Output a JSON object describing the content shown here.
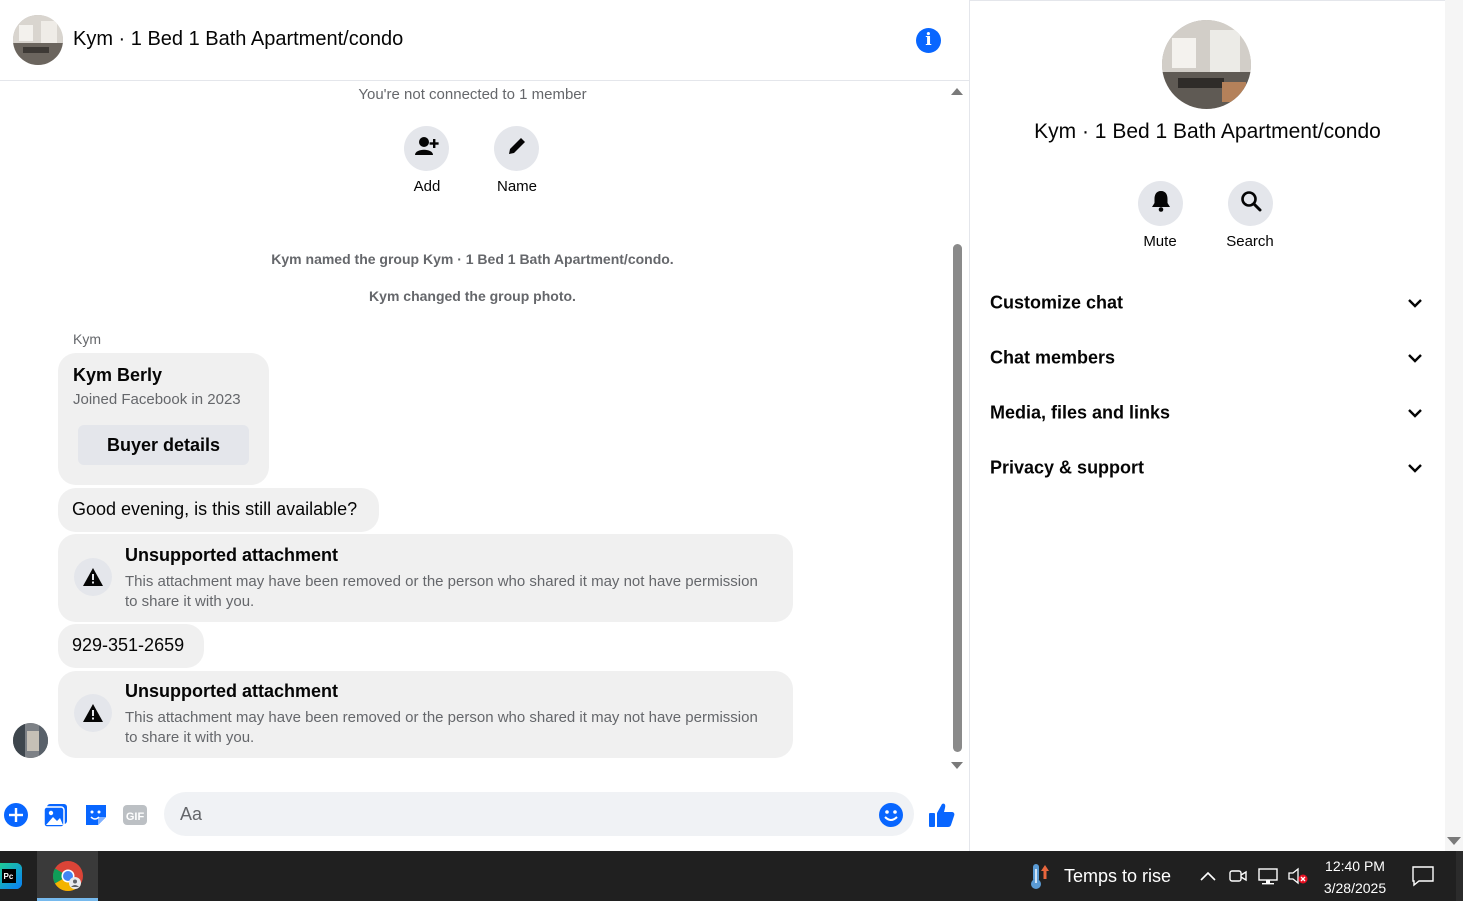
{
  "header": {
    "title": "Kym · 1 Bed 1 Bath Apartment/condo"
  },
  "chat": {
    "connection_notice": "You're not connected to 1 member",
    "actions": [
      {
        "label": "Add",
        "icon": "add-person-icon"
      },
      {
        "label": "Name",
        "icon": "pencil-icon"
      }
    ],
    "system_messages": [
      "Kym named the group Kym · 1 Bed 1 Bath Apartment/condo.",
      "Kym changed the group photo."
    ],
    "sender_name": "Kym",
    "profile_card": {
      "name": "Kym Berly",
      "subtitle": "Joined Facebook in 2023",
      "button_label": "Buyer details"
    },
    "messages": [
      {
        "type": "text",
        "text": "Good evening, is this still available?"
      },
      {
        "type": "attachment",
        "title": "Unsupported attachment",
        "description": "This attachment may have been removed or the person who shared it may not have permission to share it with you."
      },
      {
        "type": "text",
        "text": "929-351-2659"
      },
      {
        "type": "attachment",
        "title": "Unsupported attachment",
        "description": "This attachment may have been removed or the person who shared it may not have permission to share it with you."
      }
    ]
  },
  "composer": {
    "placeholder": "Aa",
    "icons": [
      "plus-icon",
      "photo-icon",
      "sticker-icon",
      "gif-icon",
      "emoji-icon",
      "thumbs-up-icon"
    ],
    "gif_label": "GIF"
  },
  "details_panel": {
    "title": "Kym · 1 Bed 1 Bath Apartment/condo",
    "actions": [
      {
        "label": "Mute",
        "icon": "bell-icon"
      },
      {
        "label": "Search",
        "icon": "search-icon"
      }
    ],
    "sections": [
      {
        "label": "Customize chat"
      },
      {
        "label": "Chat members"
      },
      {
        "label": "Media, files and links"
      },
      {
        "label": "Privacy & support"
      }
    ]
  },
  "taskbar": {
    "weather_text": "Temps to rise",
    "time": "12:40 PM",
    "date": "3/28/2025"
  },
  "colors": {
    "accent": "#0866ff",
    "bubble": "#f0f0f0",
    "muted_text": "#65676b",
    "taskbar": "#202020"
  }
}
